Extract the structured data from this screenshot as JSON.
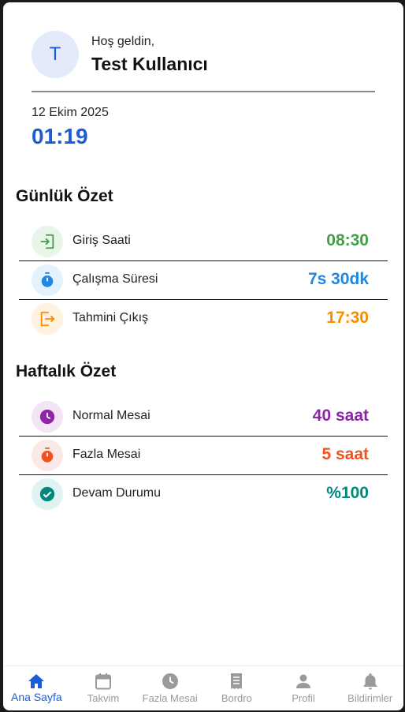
{
  "user": {
    "initial": "T",
    "greeting": "Hoş geldin,",
    "name": "Test Kullanıcı"
  },
  "datetime": {
    "date": "12 Ekim 2025",
    "time": "01:19"
  },
  "daily": {
    "title": "Günlük Özet",
    "items": [
      {
        "label": "Giriş Saati",
        "value": "08:30",
        "icon": "login-icon",
        "color": "#43a047",
        "bg": "#e8f5e9"
      },
      {
        "label": "Çalışma Süresi",
        "value": "7s 30dk",
        "icon": "timer-icon",
        "color": "#1e88e5",
        "bg": "#e3f2fd"
      },
      {
        "label": "Tahmini Çıkış",
        "value": "17:30",
        "icon": "logout-icon",
        "color": "#fb8c00",
        "bg": "#fff3e0"
      }
    ]
  },
  "weekly": {
    "title": "Haftalık Özet",
    "items": [
      {
        "label": "Normal Mesai",
        "value": "40 saat",
        "icon": "clock-icon",
        "color": "#8e24aa",
        "bg": "#f3e5f5"
      },
      {
        "label": "Fazla Mesai",
        "value": "5 saat",
        "icon": "timer-icon",
        "color": "#f4511e",
        "bg": "#fbe9e7"
      },
      {
        "label": "Devam Durumu",
        "value": "%100",
        "icon": "check-circle-icon",
        "color": "#00897b",
        "bg": "#e0f2f1"
      }
    ]
  },
  "nav": {
    "active_color": "#1e5bd8",
    "items": [
      {
        "label": "Ana Sayfa",
        "icon": "home-icon",
        "active": true
      },
      {
        "label": "Takvim",
        "icon": "calendar-icon",
        "active": false
      },
      {
        "label": "Fazla Mesai",
        "icon": "clock-icon",
        "active": false
      },
      {
        "label": "Bordro",
        "icon": "receipt-icon",
        "active": false
      },
      {
        "label": "Profil",
        "icon": "person-icon",
        "active": false
      },
      {
        "label": "Bildirimler",
        "icon": "bell-icon",
        "active": false
      }
    ]
  }
}
